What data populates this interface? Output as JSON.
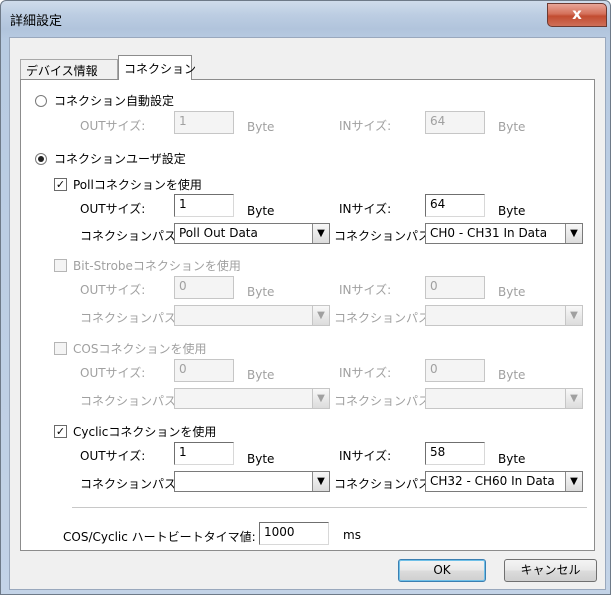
{
  "window": {
    "title": "詳細設定",
    "close_label": "x"
  },
  "tabs": [
    {
      "label": "デバイス情報"
    },
    {
      "label": "コネクション"
    }
  ],
  "auto": {
    "label": "コネクション自動設定",
    "out_label": "OUTサイズ:",
    "out_value": "1",
    "out_unit": "Byte",
    "in_label": "INサイズ:",
    "in_value": "64",
    "in_unit": "Byte",
    "selected": false
  },
  "user": {
    "label": "コネクションユーザ設定",
    "selected": true
  },
  "poll": {
    "label": "Pollコネクションを使用",
    "checked": true,
    "out_label": "OUTサイズ:",
    "out_value": "1",
    "out_unit": "Byte",
    "in_label": "INサイズ:",
    "in_value": "64",
    "in_unit": "Byte",
    "out_path_label": "コネクションパス:",
    "out_path": "Poll Out Data",
    "in_path_label": "コネクションパス:",
    "in_path": "CH0 - CH31 In Data"
  },
  "bitstrobe": {
    "label": "Bit-Strobeコネクションを使用",
    "checked": false,
    "out_label": "OUTサイズ:",
    "out_value": "0",
    "out_unit": "Byte",
    "in_label": "INサイズ:",
    "in_value": "0",
    "in_unit": "Byte",
    "out_path_label": "コネクションパス:",
    "out_path": "",
    "in_path_label": "コネクションパス:",
    "in_path": ""
  },
  "cos": {
    "label": "COSコネクションを使用",
    "checked": false,
    "out_label": "OUTサイズ:",
    "out_value": "0",
    "out_unit": "Byte",
    "in_label": "INサイズ:",
    "in_value": "0",
    "in_unit": "Byte",
    "out_path_label": "コネクションパス:",
    "out_path": "",
    "in_path_label": "コネクションパス:",
    "in_path": ""
  },
  "cyclic": {
    "label": "Cyclicコネクションを使用",
    "checked": true,
    "out_label": "OUTサイズ:",
    "out_value": "1",
    "out_unit": "Byte",
    "in_label": "INサイズ:",
    "in_value": "58",
    "in_unit": "Byte",
    "out_path_label": "コネクションパス:",
    "out_path": "",
    "in_path_label": "コネクションパス:",
    "in_path": "CH32 - CH60 In Data"
  },
  "heartbeat": {
    "label": "COS/Cyclic ハートビートタイマ値:",
    "value": "1000",
    "unit": "ms"
  },
  "buttons": {
    "ok": "OK",
    "cancel": "キャンセル"
  }
}
